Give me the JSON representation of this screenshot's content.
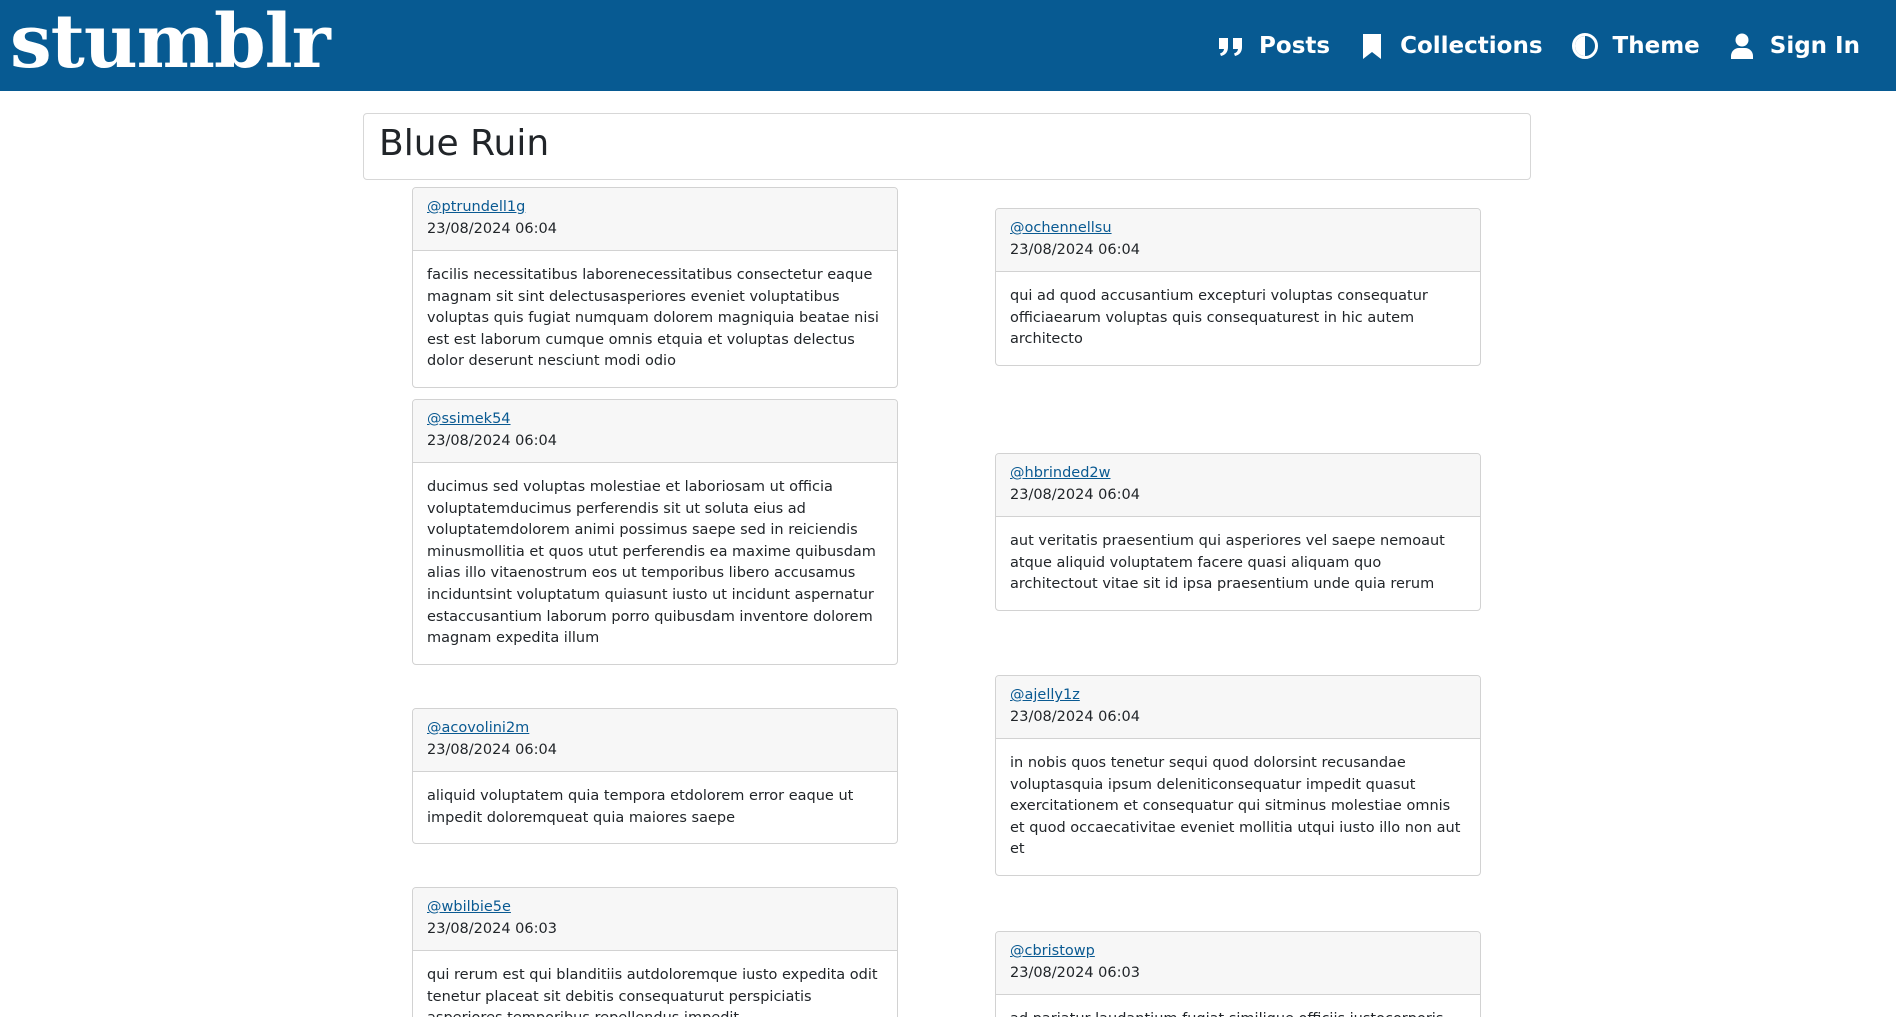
{
  "navbar": {
    "brand": "stumblr",
    "items": [
      {
        "label": "Posts",
        "icon": "quote-icon"
      },
      {
        "label": "Collections",
        "icon": "bookmark-icon"
      },
      {
        "label": "Theme",
        "icon": "contrast-icon"
      },
      {
        "label": "Sign In",
        "icon": "user-icon"
      }
    ]
  },
  "page": {
    "title": "Blue Ruin"
  },
  "posts": [
    {
      "author": "@ptrundell1g",
      "timestamp": "23/08/2024 06:04",
      "body": "facilis necessitatibus laborenecessitatibus consectetur eaque magnam sit sint delectusasperiores eveniet voluptatibus voluptas quis fugiat numquam dolorem magniquia beatae nisi est est laborum cumque omnis etquia et voluptas delectus dolor deserunt nesciunt modi odio"
    },
    {
      "author": "@ochennellsu",
      "timestamp": "23/08/2024 06:04",
      "body": "qui ad quod accusantium excepturi voluptas consequatur officiaearum voluptas quis consequaturest in hic autem architecto"
    },
    {
      "author": "@ssimek54",
      "timestamp": "23/08/2024 06:04",
      "body": "ducimus sed voluptas molestiae et laboriosam ut officia voluptatemducimus perferendis sit ut soluta eius ad voluptatemdolorem animi possimus saepe sed in reiciendis minusmollitia et quos utut perferendis ea maxime quibusdam alias illo vitaenostrum eos ut temporibus libero accusamus inciduntsint voluptatum quiasunt iusto ut incidunt aspernatur estaccusantium laborum porro quibusdam inventore dolorem magnam expedita illum"
    },
    {
      "author": "@hbrinded2w",
      "timestamp": "23/08/2024 06:04",
      "body": "aut veritatis praesentium qui asperiores vel saepe nemoaut atque aliquid voluptatem facere quasi aliquam quo architectout vitae sit id ipsa praesentium unde quia rerum"
    },
    {
      "author": "@ajelly1z",
      "timestamp": "23/08/2024 06:04",
      "body": "in nobis quos tenetur sequi quod dolorsint recusandae voluptasquia ipsum deleniticonsequatur impedit quasut exercitationem et consequatur qui sitminus molestiae omnis et quod occaecativitae eveniet mollitia utqui iusto illo non aut et"
    },
    {
      "author": "@acovolini2m",
      "timestamp": "23/08/2024 06:04",
      "body": "aliquid voluptatem quia tempora etdolorem error eaque ut impedit doloremqueat quia maiores saepe"
    },
    {
      "author": "@wbilbie5e",
      "timestamp": "23/08/2024 06:03",
      "body": "qui rerum est qui blanditiis autdoloremque iusto expedita odit tenetur placeat sit debitis consequaturut perspiciatis asperiores temporibus repellendus impedit"
    },
    {
      "author": "@cbristowp",
      "timestamp": "23/08/2024 06:03",
      "body": "ad pariatur laudantium fugiat similique officiis iustocorporis"
    }
  ]
}
